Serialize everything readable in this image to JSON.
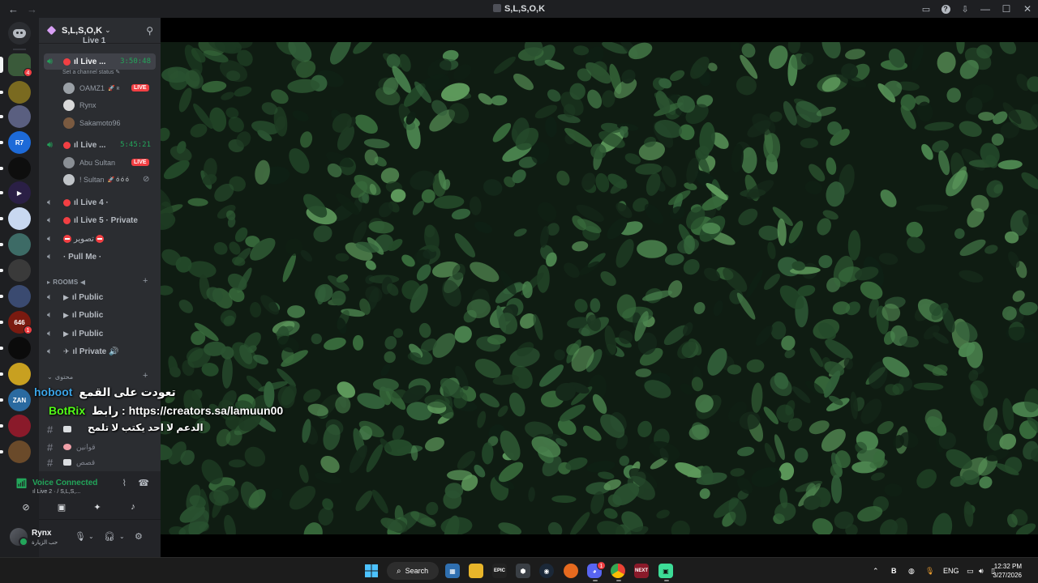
{
  "window": {
    "title": "S,L,S,O,K",
    "back": "←",
    "forward": "→",
    "minimize": "—",
    "maximize": "☐",
    "close": "✕"
  },
  "guild": {
    "name": "S,L,S,O,K",
    "chevron": "⌄"
  },
  "channels": {
    "partial_top": "Live 1",
    "live2": {
      "name": "ıl Live ...",
      "timer": "3:50:48",
      "status": "Set a channel status ✎"
    },
    "live2_users": [
      {
        "name": "OAMZ1",
        "extra": "🚀 ʀ",
        "badge": "LIVE"
      },
      {
        "name": "Rynx",
        "extra": "",
        "badge": ""
      },
      {
        "name": "Sakamoto96",
        "extra": "",
        "badge": ""
      }
    ],
    "live3": {
      "name": "ıl Live ...",
      "timer": "5:45:21"
    },
    "live3_users": [
      {
        "name": "Abu Sultan",
        "extra": "",
        "badge": "LIVE"
      },
      {
        "name": "! Sultan",
        "extra": "🚀 ó ó ó",
        "badge": ""
      }
    ],
    "live4": "ıl Live 4 ·",
    "live5": "ıl Live 5 · Private",
    "photographer": "تصوير",
    "pullme": "· Pull Me ·",
    "rooms_category": "ROOMS ◀",
    "rooms": [
      "ıl Public",
      "ıl Public",
      "ıl Public",
      "ıl Private 🔊"
    ],
    "content_category": "محتوى",
    "text_channels": [
      "قوانين",
      "قصص"
    ]
  },
  "overlay": [
    {
      "name": "hoboot",
      "message": "تعودت على القمع"
    },
    {
      "name": "BotRix",
      "message": "رابط : https://creators.sa/lamuun00"
    },
    {
      "name": "",
      "message": "الدعم لا احد يكتب لا تلمح"
    }
  ],
  "voice": {
    "label": "Voice Connected",
    "sub": "ıl Live 2 · / S,L,S,..."
  },
  "user": {
    "name": "Rynx",
    "status": "حب الزيارة"
  },
  "taskbar": {
    "search": "Search",
    "lang": "ENG",
    "time": "12:32 PM",
    "date": "3/27/2026"
  },
  "servers": [
    {
      "label": "",
      "color": "#3a5a3a",
      "badge": "4"
    },
    {
      "label": "",
      "color": "#7a6a20",
      "badge": ""
    },
    {
      "label": "",
      "color": "#5a5f80",
      "badge": ""
    },
    {
      "label": "R7",
      "color": "#1d6ad8",
      "badge": ""
    },
    {
      "label": "",
      "color": "#0e0e0e",
      "badge": ""
    },
    {
      "label": "▶",
      "color": "#2a1f45",
      "badge": ""
    },
    {
      "label": "",
      "color": "#c8d8f0",
      "badge": ""
    },
    {
      "label": "",
      "color": "#3d6b66",
      "badge": ""
    },
    {
      "label": "",
      "color": "#3a3a3a",
      "badge": ""
    },
    {
      "label": "",
      "color": "#3a4a70",
      "badge": ""
    },
    {
      "label": "646",
      "color": "#7a1a10",
      "badge": "1"
    },
    {
      "label": "",
      "color": "#0b0b0b",
      "badge": ""
    },
    {
      "label": "",
      "color": "#c8a020",
      "badge": ""
    },
    {
      "label": "ZAN",
      "color": "#2a6aa0",
      "badge": ""
    },
    {
      "label": "",
      "color": "#8a1a2a",
      "badge": ""
    },
    {
      "label": "",
      "color": "#6a4a2a",
      "badge": ""
    }
  ]
}
